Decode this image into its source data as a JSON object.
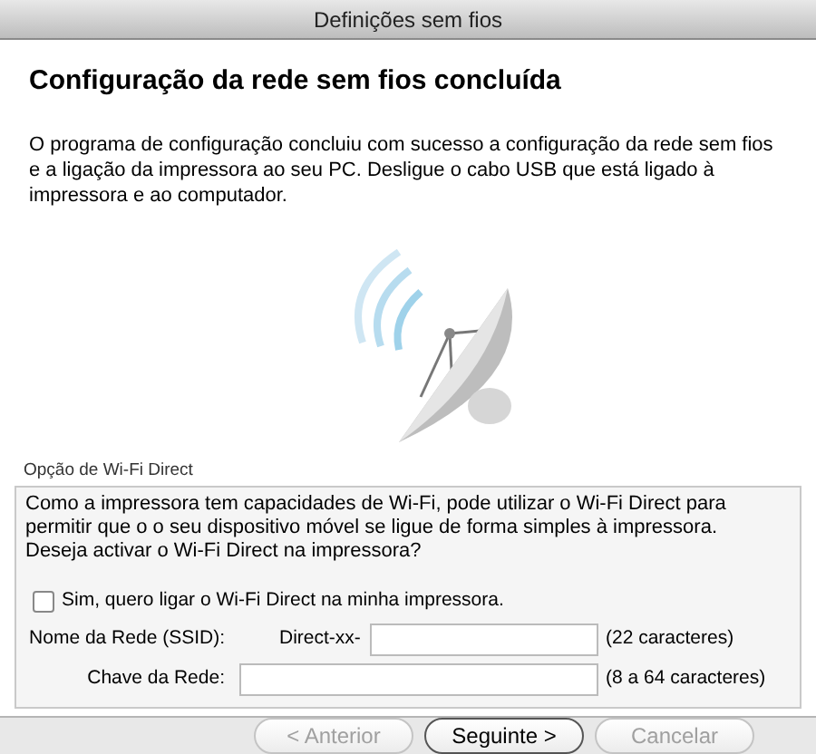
{
  "window": {
    "title": "Definições sem fios"
  },
  "heading": "Configuração da rede sem fios concluída",
  "message": "O programa de configuração concluiu com sucesso a configuração da rede sem fios e a ligação da impressora ao seu PC. Desligue o cabo USB que está ligado à impressora e ao computador.",
  "wifi_direct": {
    "label": "Opção de Wi-Fi Direct",
    "description": [
      "Como a impressora tem capacidades de Wi-Fi, pode utilizar o Wi-Fi Direct para permitir que o o seu dispositivo móvel se ligue de forma simples à impressora.",
      "Deseja activar o Wi-Fi Direct na impressora?"
    ],
    "checkbox": {
      "label": "Sim, quero ligar o Wi-Fi Direct na minha impressora.",
      "checked": false
    },
    "fields": [
      {
        "label": "Nome da Rede (SSID):",
        "prefix": "Direct-xx-",
        "hint": "(22 caracteres)"
      },
      {
        "label": "Chave da Rede:",
        "hint": "(8 a 64 caracteres)"
      }
    ]
  },
  "buttons": [
    {
      "label": "< Anterior",
      "disabled": true,
      "default": false
    },
    {
      "label": "Seguinte >",
      "disabled": false,
      "default": true
    },
    {
      "label": "Cancelar",
      "disabled": true,
      "default": false
    }
  ]
}
